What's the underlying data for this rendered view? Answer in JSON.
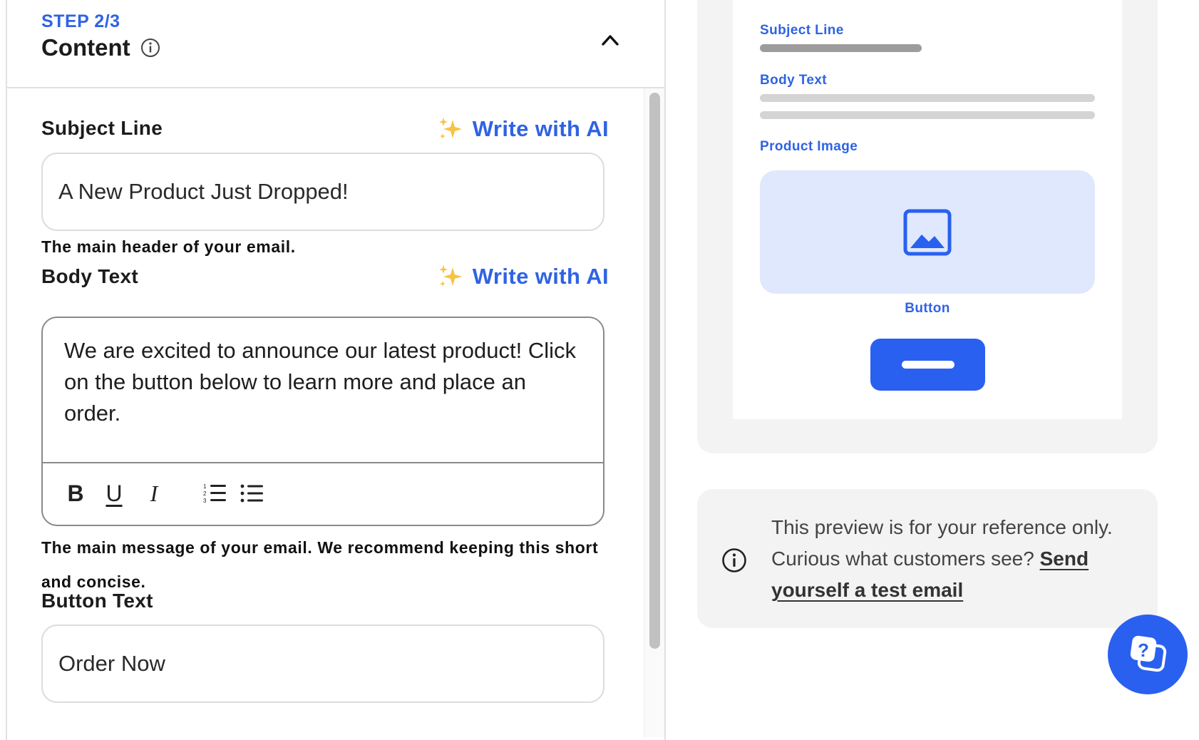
{
  "step": {
    "label": "STEP 2/3",
    "title": "Content"
  },
  "fields": {
    "subject": {
      "label": "Subject Line",
      "ai_label": "Write with AI",
      "value": "A New Product Just Dropped!",
      "help": "The main header of your email."
    },
    "body": {
      "label": "Body Text",
      "ai_label": "Write with AI",
      "value": "We are excited to announce our latest product! Click on the button below to learn more and place an order.",
      "help": "The main message of your email. We recommend keeping this short and concise.",
      "toolbar": {
        "bold": "B",
        "underline": "U",
        "italic": "I"
      }
    },
    "button": {
      "label": "Button Text",
      "value": "Order Now"
    }
  },
  "preview": {
    "subject_label": "Subject Line",
    "body_label": "Body Text",
    "image_label": "Product Image",
    "button_label": "Button",
    "accent_color": "#2a60f0",
    "image_bg": "#dfe8fc"
  },
  "notice": {
    "text": "This preview is for your reference only. Curious what customers see?",
    "link": "Send yourself a test email"
  },
  "colors": {
    "brand_blue": "#2f63e3",
    "border": "#dcdcdc"
  }
}
